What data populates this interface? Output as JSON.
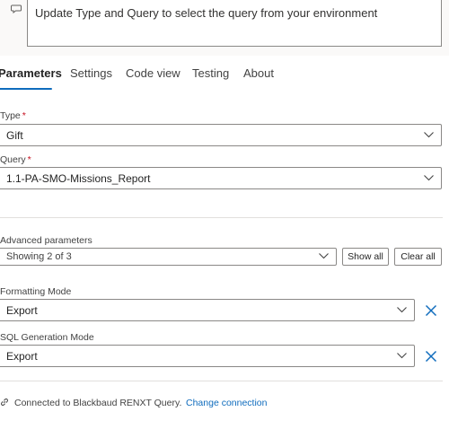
{
  "comment": {
    "icon": "comment-icon",
    "text": "Update Type and Query to select the query from your environment"
  },
  "tabs": [
    {
      "label": "Parameters",
      "active": true
    },
    {
      "label": "Settings",
      "active": false
    },
    {
      "label": "Code view",
      "active": false
    },
    {
      "label": "Testing",
      "active": false
    },
    {
      "label": "About",
      "active": false
    }
  ],
  "fields": {
    "type": {
      "label": "Type",
      "required": "*",
      "value": "Gift"
    },
    "query": {
      "label": "Query",
      "required": "*",
      "value": "1.1-PA-SMO-Missions_Report"
    }
  },
  "advanced": {
    "label": "Advanced parameters",
    "value": "Showing 2 of 3",
    "show_all": "Show all",
    "clear_all": "Clear all"
  },
  "extra_fields": {
    "formatting": {
      "label": "Formatting Mode",
      "value": "Export"
    },
    "sql": {
      "label": "SQL Generation Mode",
      "value": "Export"
    }
  },
  "connection": {
    "icon": "link-icon",
    "text": "Connected to Blackbaud RENXT Query.",
    "link": "Change connection"
  },
  "colors": {
    "accent": "#0f6cbd",
    "required": "#c50f1f",
    "border": "#8a8886"
  }
}
